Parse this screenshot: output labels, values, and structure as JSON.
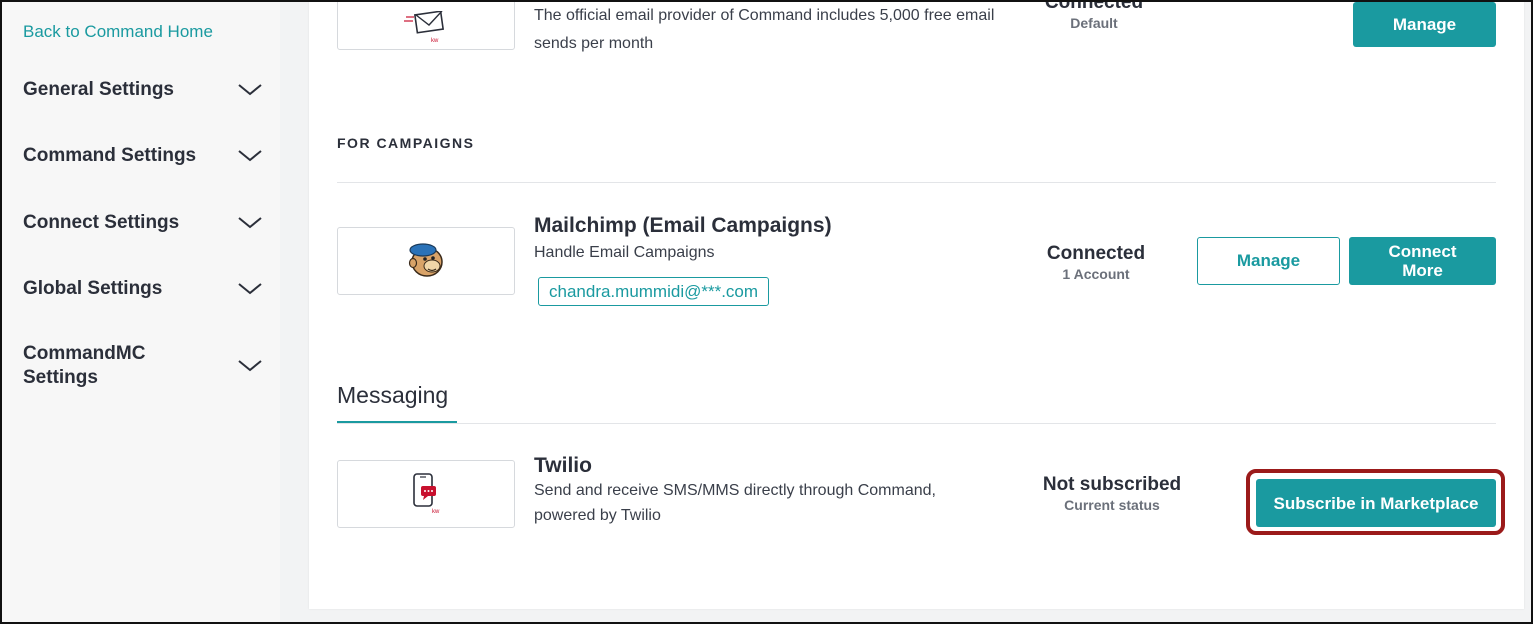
{
  "sidebar": {
    "back_link": "Back to Command Home",
    "items": [
      {
        "label": "General Settings"
      },
      {
        "label": "Command Settings"
      },
      {
        "label": "Connect Settings"
      },
      {
        "label": "Global Settings"
      },
      {
        "label": "CommandMC Settings"
      }
    ]
  },
  "email_provider": {
    "description": "The official email provider of Command includes 5,000 free email sends per month",
    "status": "Connected",
    "status_sub": "Default",
    "manage_label": "Manage",
    "logo_icon": "email-envelope-icon"
  },
  "campaigns": {
    "section_label": "FOR CAMPAIGNS",
    "mailchimp": {
      "title": "Mailchimp (Email Campaigns)",
      "description": "Handle Email Campaigns",
      "account_tag": "chandra.mummidi@***.com",
      "status": "Connected",
      "status_sub": "1 Account",
      "manage_label": "Manage",
      "connect_more_label": "Connect More",
      "logo_icon": "mailchimp-logo-icon"
    }
  },
  "messaging": {
    "heading": "Messaging",
    "twilio": {
      "title": "Twilio",
      "description": "Send and receive SMS/MMS directly through Command, powered by Twilio",
      "status": "Not subscribed",
      "status_sub": "Current status",
      "subscribe_label": "Subscribe in Marketplace",
      "logo_icon": "phone-sms-icon"
    }
  },
  "colors": {
    "accent": "#1a9aa0",
    "highlight": "#9b1a1a",
    "kw_red": "#c8102e"
  }
}
